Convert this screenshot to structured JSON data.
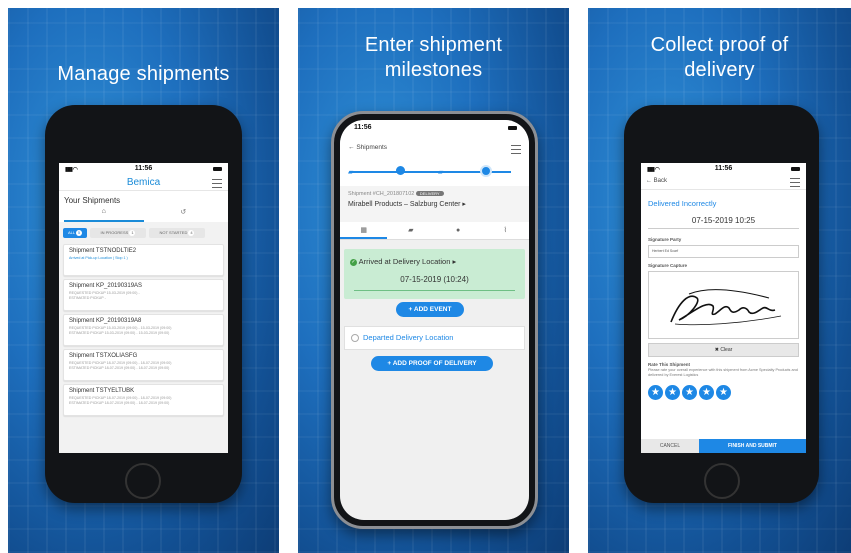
{
  "panel1": {
    "headline": "Manage shipments",
    "status_time": "11:56",
    "brand": "Bemica",
    "section_title": "Your Shipments",
    "filters": [
      {
        "label": "ALL",
        "count": "5"
      },
      {
        "label": "IN PROGRESS",
        "count": "1"
      },
      {
        "label": "NOT STARTED",
        "count": "4"
      }
    ],
    "shipments": [
      {
        "title": "Shipment  TSTNODLTIE2",
        "line1": "Arrived at Pick-up Location  ( Stop 1 )",
        "line2": ""
      },
      {
        "title": "Shipment  KP_20190319AS",
        "line1": "REQUESTED PICKUP  15-03-2019 (09:00) -",
        "line2": "ESTIMATED PICKUP  -"
      },
      {
        "title": "Shipment  KP_20190319A8",
        "line1": "REQUESTED PICKUP  15-03-2019 (09:00) - 15-03-2019 (09:00)",
        "line2": "ESTIMATED PICKUP  15-03-2019 (09:00) - 15-03-2019 (09:00)"
      },
      {
        "title": "Shipment  TSTXOLIASFG",
        "line1": "REQUESTED PICKUP  18-07-2019 (09:00) - 18-07-2019 (09:00)",
        "line2": "ESTIMATED PICKUP  18-07-2019 (09:00) - 18-07-2019 (09:00)"
      },
      {
        "title": "Shipment  TSTYELTUBK",
        "line1": "REQUESTED PICKUP  18-07-2019 (09:00) - 18-07-2019 (09:00)",
        "line2": "ESTIMATED PICKUP  18-07-2019 (09:00) - 18-07-2019 (09:00)"
      }
    ]
  },
  "panel2": {
    "headline_line1": "Enter shipment",
    "headline_line2": "milestones",
    "status_time": "11:56",
    "back_label": "Shipments",
    "shipment_id": "Shipment #CH_201807102",
    "status_badge": "DELIVERY",
    "route": "Mirabell Products – Salzburg Center",
    "milestone_done": "Arrived at Delivery Location",
    "milestone_date": "07-15-2019 (10:24)",
    "add_event": "ADD EVENT",
    "milestone_next": "Departed Delivery Location",
    "add_pod": "ADD PROOF OF DELIVERY"
  },
  "panel3": {
    "headline_line1": "Collect proof of",
    "headline_line2": "delivery",
    "status_time": "11:56",
    "back_label": "Back",
    "status": "Delivered Incorrectly",
    "datetime": "07-15-2019  10:25",
    "sig_party_label": "Signature Party",
    "sig_party_value": "Herbert Ed Scarf",
    "sig_capture_label": "Signature Capture",
    "clear": "Clear",
    "rate_title": "Rate This Shipment",
    "rate_text": "Please rate your overall experience with this shipment from Acme Specialty Products and delivered by Everest Logistics",
    "cancel": "CANCEL",
    "finish": "FINISH AND SUBMIT"
  },
  "colors": {
    "brand_blue": "#1e88e5",
    "success_green": "#c9ecd3"
  }
}
